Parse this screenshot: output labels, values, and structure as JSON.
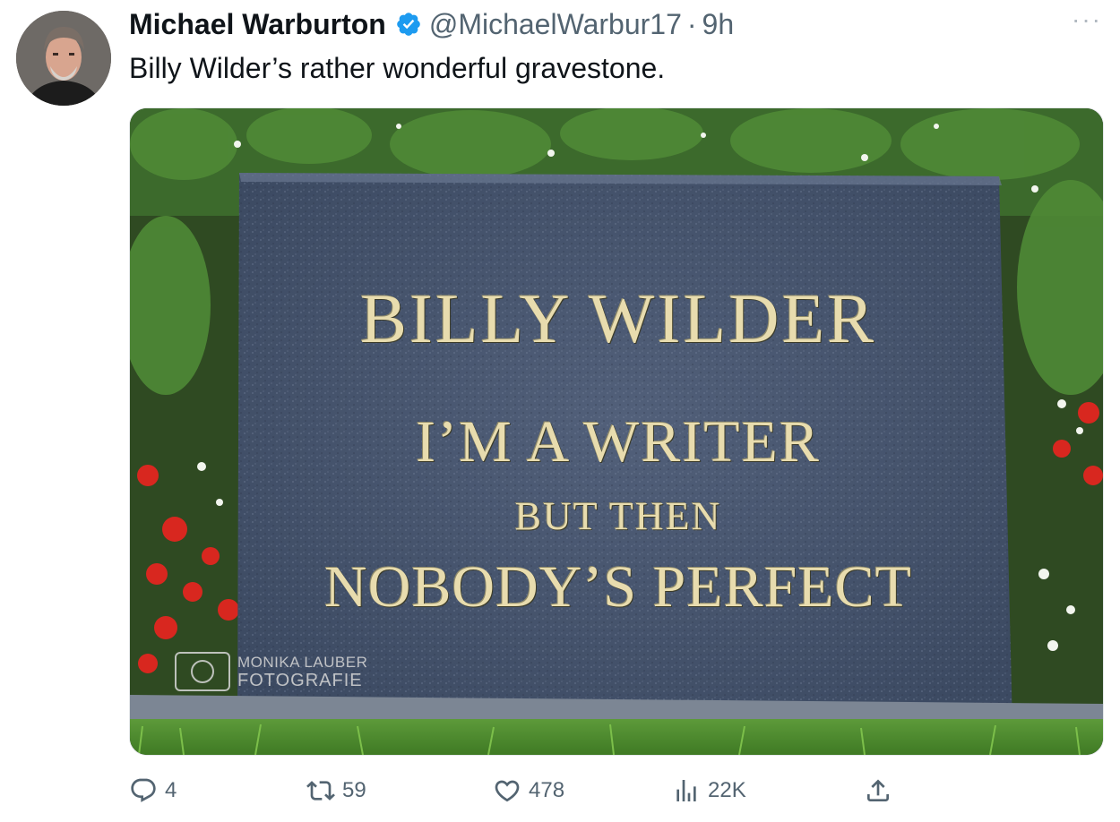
{
  "tweet": {
    "author_name": "Michael Warburton",
    "handle": "@MichaelWarbur17",
    "separator": "·",
    "time": "9h",
    "more_label": "···",
    "text": "Billy Wilder’s rather wonderful gravestone."
  },
  "image": {
    "gravestone_name": "BILLY WILDER",
    "epitaph_line1": "I’M A WRITER",
    "epitaph_line2": "BUT THEN",
    "epitaph_line3": "NOBODY’S PERFECT",
    "watermark_top": "MONIKA LAUBER",
    "watermark_bottom": "FOTOGRAFIE"
  },
  "actions": {
    "replies": "4",
    "reposts": "59",
    "likes": "478",
    "views": "22K"
  },
  "icons": {
    "verified": "verified-badge-icon",
    "more": "more-icon",
    "reply": "reply-icon",
    "repost": "repost-icon",
    "like": "like-icon",
    "views": "views-icon",
    "share": "share-icon"
  },
  "colors": {
    "verified_blue": "#1d9bf0",
    "secondary_text": "#536471",
    "primary_text": "#0f1419",
    "stone_lettering": "#e8dcae",
    "stone": "#4a5a74"
  }
}
